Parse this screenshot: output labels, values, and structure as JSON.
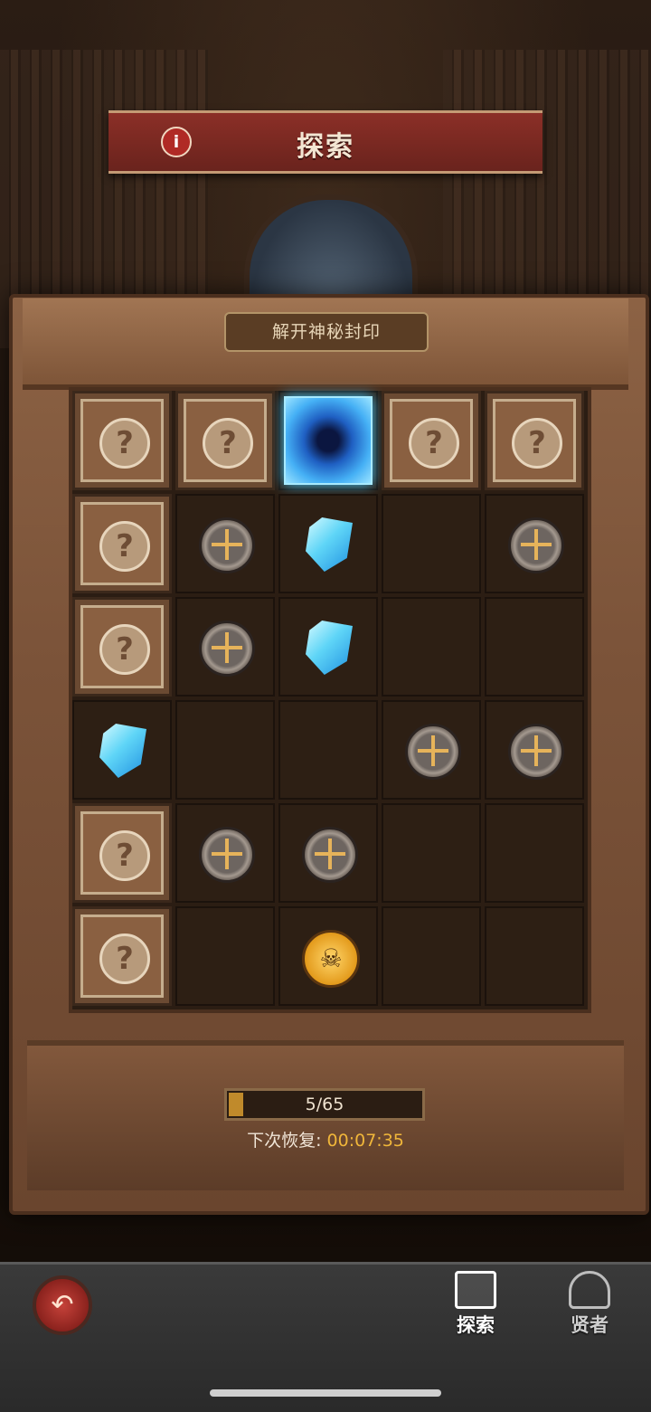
{
  "header": {
    "title": "探索"
  },
  "board": {
    "subtitle": "解开神秘封印",
    "grid": [
      [
        "sealed",
        "sealed",
        "portal",
        "sealed",
        "sealed"
      ],
      [
        "sealed",
        "medal",
        "crystal",
        "empty",
        "medal"
      ],
      [
        "sealed",
        "medal",
        "crystal",
        "empty",
        "empty"
      ],
      [
        "crystal",
        "empty",
        "empty",
        "medal",
        "medal"
      ],
      [
        "sealed",
        "medal",
        "medal",
        "empty",
        "empty"
      ],
      [
        "sealed",
        "empty",
        "skull-coin",
        "empty",
        "empty"
      ]
    ],
    "sealed_symbol": "?"
  },
  "energy": {
    "progress_text": "5/65",
    "current": 5,
    "max": 65,
    "recover_label": "下次恢复:",
    "recover_time": "00:07:35"
  },
  "bottom_nav": {
    "items": [
      {
        "label": "探索",
        "icon": "shelf-icon",
        "active": true
      },
      {
        "label": "贤者",
        "icon": "hooded-sage-icon",
        "active": false
      }
    ]
  },
  "colors": {
    "accent": "#f0b63a",
    "banner": "#8b2f27",
    "crystal": "#45b0f5"
  }
}
